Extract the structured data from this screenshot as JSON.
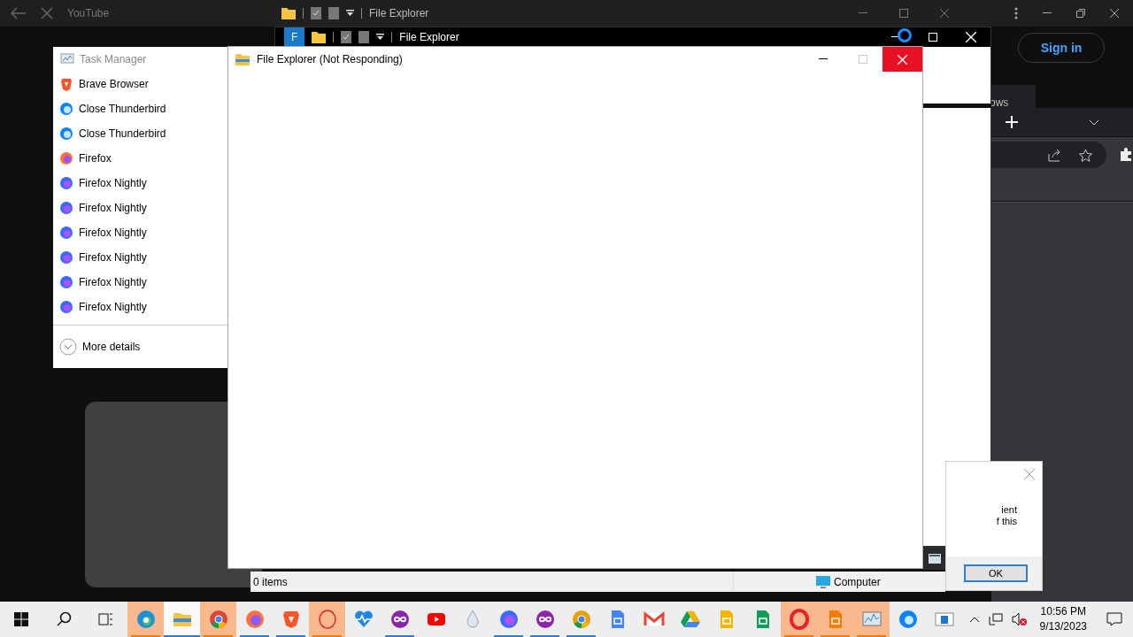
{
  "browser": {
    "tab_title": "YouTube",
    "sign_in": "Sign in",
    "partial_text": "ows"
  },
  "explorer_back": [
    {
      "title": "File Explorer"
    },
    {
      "title": "File Explorer",
      "partial_tab": "F"
    }
  ],
  "jump_list": {
    "header": "Task Manager",
    "items": [
      {
        "label": "Brave Browser",
        "kind": "brave"
      },
      {
        "label": "Close Thunderbird",
        "kind": "thunderbird"
      },
      {
        "label": "Close Thunderbird",
        "kind": "thunderbird"
      },
      {
        "label": "Firefox",
        "kind": "firefox"
      },
      {
        "label": "Firefox Nightly",
        "kind": "nightly"
      },
      {
        "label": "Firefox Nightly",
        "kind": "nightly"
      },
      {
        "label": "Firefox Nightly",
        "kind": "nightly"
      },
      {
        "label": "Firefox Nightly",
        "kind": "nightly"
      },
      {
        "label": "Firefox Nightly",
        "kind": "nightly"
      },
      {
        "label": "Firefox Nightly",
        "kind": "nightly"
      }
    ],
    "more": "More details"
  },
  "main_window": {
    "title": "File Explorer (Not Responding)"
  },
  "status_bar": {
    "items": "0 items",
    "location": "Computer"
  },
  "dialog": {
    "lines": [
      "ient",
      "f this"
    ],
    "ok": "OK"
  },
  "taskbar": {
    "apps": [
      {
        "kind": "edge",
        "flashing": true,
        "selected": false,
        "running": true
      },
      {
        "kind": "explorer",
        "flashing": false,
        "selected": true,
        "running": true
      },
      {
        "kind": "chrome",
        "flashing": true,
        "selected": false,
        "running": true
      },
      {
        "kind": "firefox",
        "flashing": false,
        "selected": false,
        "running": true
      },
      {
        "kind": "brave",
        "flashing": false,
        "selected": false,
        "running": true
      },
      {
        "kind": "operagx",
        "flashing": true,
        "selected": false,
        "running": true
      },
      {
        "kind": "health",
        "flashing": false,
        "selected": false,
        "running": false
      },
      {
        "kind": "infinity",
        "flashing": false,
        "selected": false,
        "running": true
      },
      {
        "kind": "youtube",
        "flashing": false,
        "selected": false,
        "running": false
      },
      {
        "kind": "drop",
        "flashing": false,
        "selected": false,
        "running": false
      },
      {
        "kind": "nightly",
        "flashing": false,
        "selected": false,
        "running": true
      },
      {
        "kind": "infinity",
        "flashing": false,
        "selected": false,
        "running": true
      },
      {
        "kind": "canary",
        "flashing": false,
        "selected": false,
        "running": true
      },
      {
        "kind": "docs",
        "flashing": false,
        "selected": false,
        "running": false
      },
      {
        "kind": "gmail",
        "flashing": false,
        "selected": false,
        "running": false
      },
      {
        "kind": "drive",
        "flashing": false,
        "selected": false,
        "running": false
      },
      {
        "kind": "slides",
        "flashing": false,
        "selected": false,
        "running": false
      },
      {
        "kind": "sheets",
        "flashing": false,
        "selected": false,
        "running": false
      },
      {
        "kind": "opera",
        "flashing": true,
        "selected": false,
        "running": true
      },
      {
        "kind": "pdf",
        "flashing": true,
        "selected": false,
        "running": true
      },
      {
        "kind": "monitor",
        "flashing": true,
        "selected": false,
        "running": true
      },
      {
        "kind": "thunderbird",
        "flashing": false,
        "selected": false,
        "running": false
      },
      {
        "kind": "window",
        "flashing": false,
        "selected": false,
        "running": false
      }
    ],
    "tray": {
      "time": "10:56 PM",
      "date": "9/13/2023",
      "muted": true
    }
  }
}
